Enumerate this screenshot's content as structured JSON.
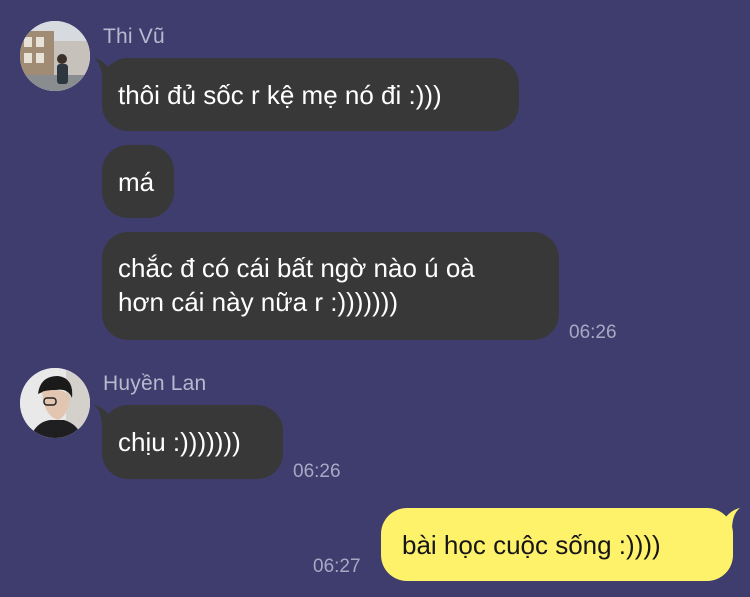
{
  "colors": {
    "background": "#3f3d6e",
    "incoming_bubble": "#383839",
    "outgoing_bubble": "#fef26b"
  },
  "messages": {
    "thi_vu": {
      "sender": "Thi Vũ",
      "bubble1": "thôi đủ sốc r kệ mẹ nó đi :)))",
      "bubble2": "má",
      "bubble3_line1": "chắc đ có cái bất ngờ nào ú oà",
      "bubble3_line2": "hơn cái này nữa r :)))))))",
      "time": "06:26"
    },
    "huyen_lan": {
      "sender": "Huyền Lan",
      "bubble1": "chịu :)))))))",
      "time": "06:26"
    },
    "me": {
      "bubble1": "bài học cuộc sống :))))",
      "time": "06:27"
    }
  }
}
